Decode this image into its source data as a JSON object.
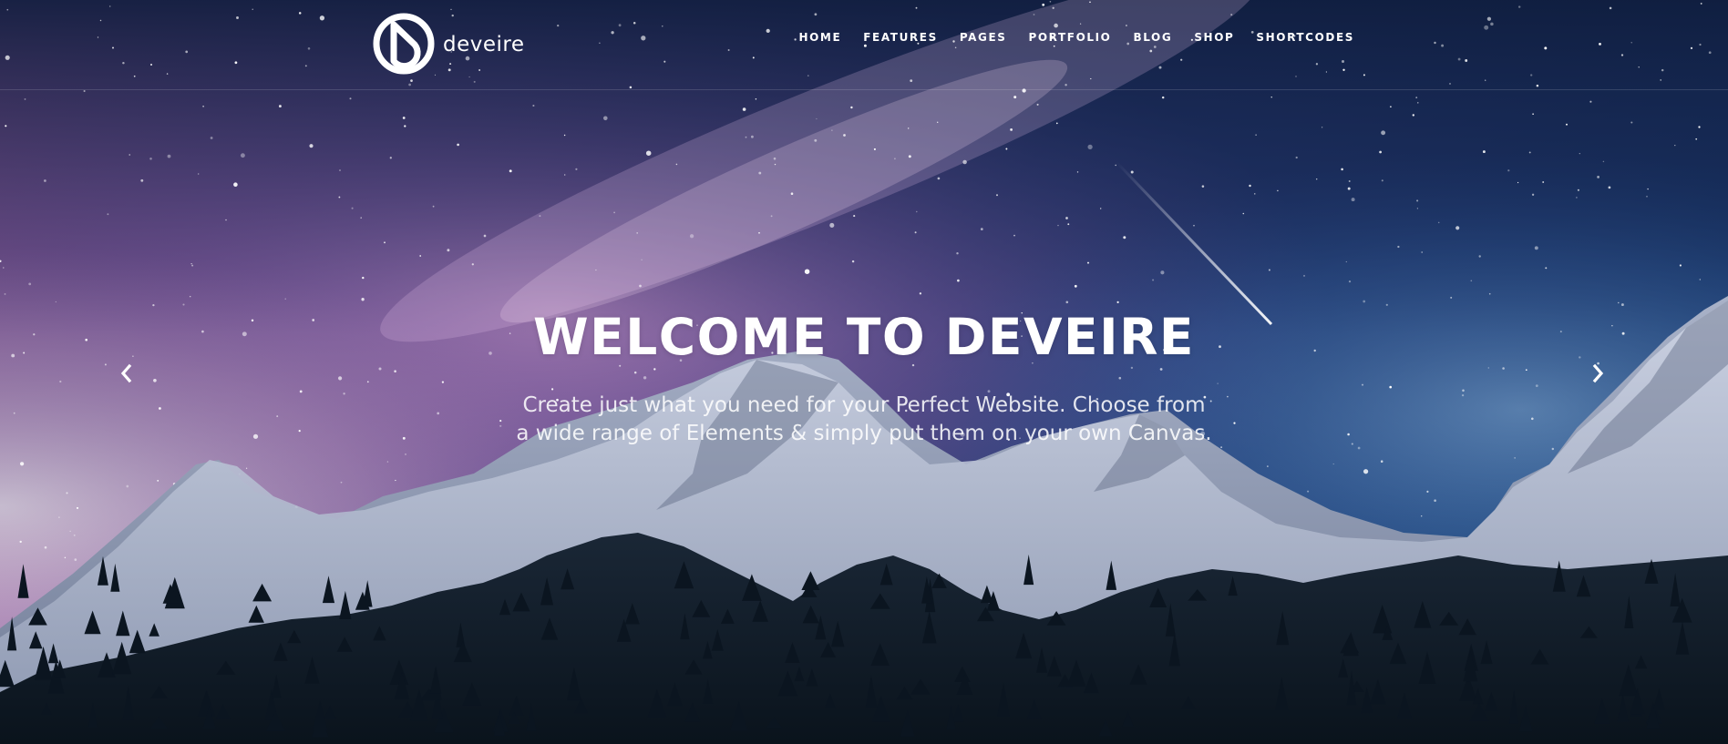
{
  "header": {
    "logo_text": "deveire",
    "nav": [
      {
        "label": "HOME"
      },
      {
        "label": "FEATURES"
      },
      {
        "label": "PAGES"
      },
      {
        "label": "PORTFOLIO"
      },
      {
        "label": "BLOG"
      },
      {
        "label": "SHOP"
      },
      {
        "label": "SHORTCODES"
      }
    ]
  },
  "hero": {
    "headline": "WELCOME TO DEVEIRE",
    "subtext": "Create just what you need for your Perfect Website. Choose from a wide range of Elements & simply put them on your own Canvas.",
    "prev_icon": "chevron-left-icon",
    "next_icon": "chevron-right-icon"
  },
  "colors": {
    "text": "#ffffff",
    "sky_top": "#1b2d5a",
    "sky_glow_pink": "#e58ed6",
    "sky_right_blue": "#3f7ecf",
    "mountain_snow": "#cfd6e6",
    "forest": "#0c1722"
  }
}
